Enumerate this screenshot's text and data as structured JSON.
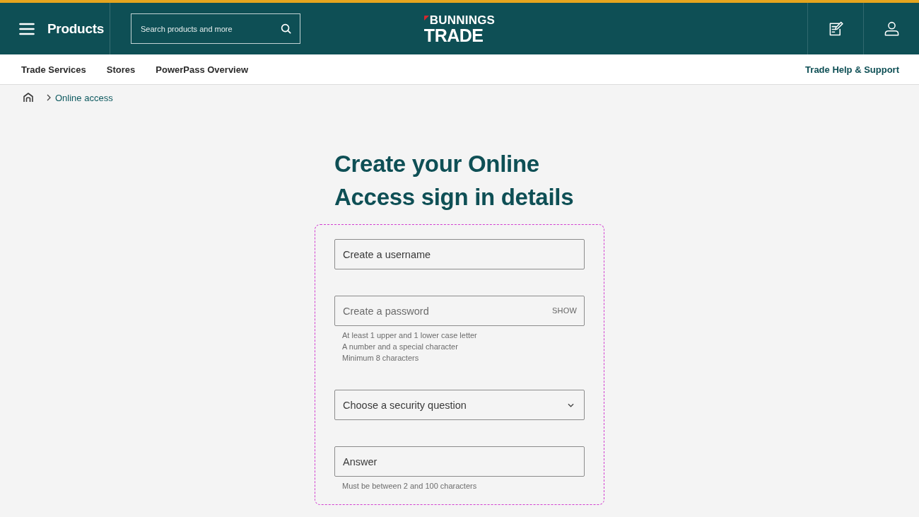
{
  "header": {
    "menu_label": "Products",
    "search": {
      "placeholder": "Search products and more"
    },
    "logo": {
      "line_1": "BUNNINGS",
      "line_2": "TRADE"
    }
  },
  "nav": {
    "items": [
      {
        "label": "Trade Services"
      },
      {
        "label": "Stores"
      },
      {
        "label": "PowerPass Overview"
      }
    ],
    "help_link": "Trade Help & Support"
  },
  "breadcrumb": {
    "items": [
      {
        "label": "Online access"
      }
    ]
  },
  "page_title": "Create your Online Access sign in details",
  "form": {
    "fields": [
      {
        "kind": "text",
        "placeholder": "Create a username"
      },
      {
        "kind": "password",
        "placeholder": "Create a password",
        "toggle": "SHOW",
        "hints": [
          "At least 1 upper and 1 lower case letter",
          "A number and a special character",
          "Minimum 8 characters"
        ]
      },
      {
        "kind": "select",
        "placeholder": "Choose a security question"
      },
      {
        "kind": "text",
        "placeholder": "Answer",
        "hints": [
          "Must be between 2 and 100 characters"
        ]
      }
    ]
  }
}
